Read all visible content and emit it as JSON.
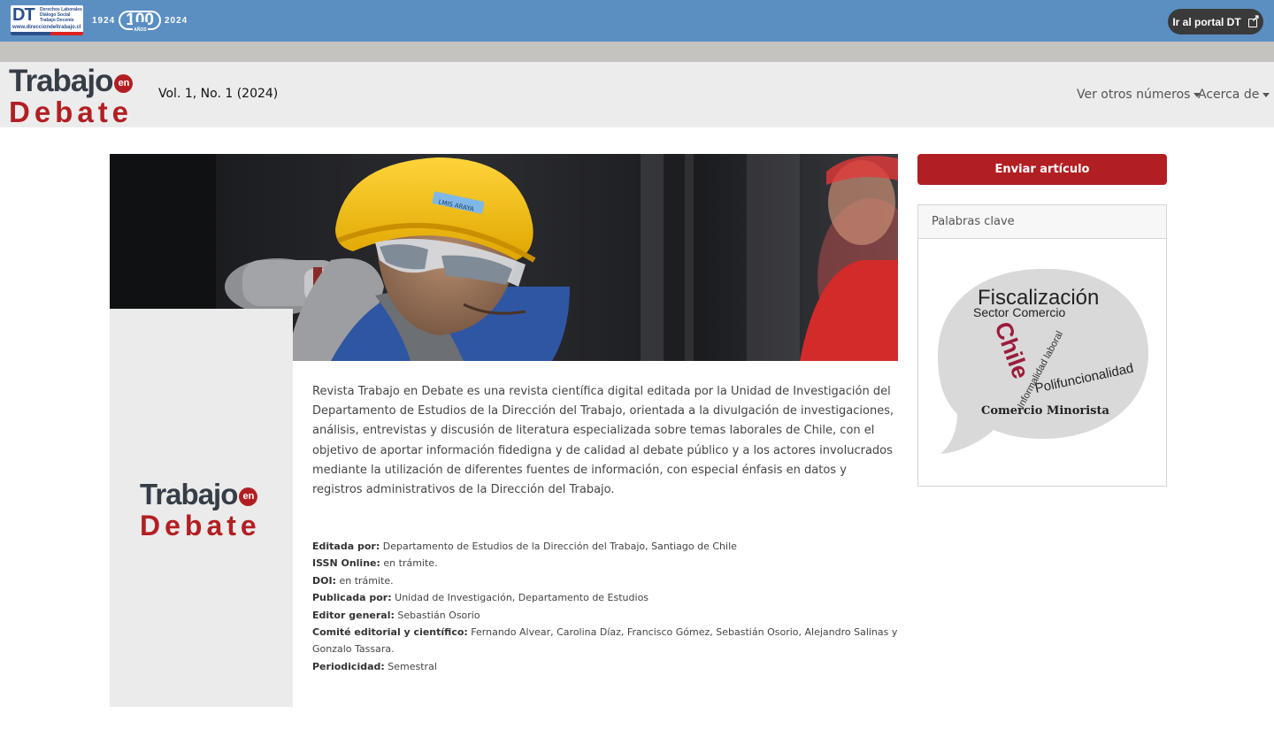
{
  "topbar": {
    "dt_logo": {
      "letters": "DT",
      "lines": [
        "Derechos Laborales",
        "Diálogo Social",
        "Trabajo Decente"
      ],
      "url": "www.direcciondeltrabajo.cl"
    },
    "anniversary": {
      "start_year": "1924",
      "number": "100",
      "label": "AÑOS",
      "end_year": "2024"
    },
    "portal_button": {
      "label": "Ir al portal DT",
      "icon": "external-link-icon"
    }
  },
  "header": {
    "logo": {
      "word1": "Trabajo",
      "badge": "en",
      "word2": "Debate"
    },
    "issue_title": "Vol. 1, No. 1 (2024)",
    "nav": [
      {
        "label": "Ver otros números",
        "icon": "chevron-down-icon"
      },
      {
        "label": "Acerca de",
        "icon": "chevron-down-icon"
      }
    ]
  },
  "main": {
    "logo": {
      "word1": "Trabajo",
      "badge": "en",
      "word2": "Debate"
    },
    "hero_helmet_label": "LMIS ARAYA",
    "description": "Revista Trabajo en Debate es una revista científica digital editada por la Unidad de Investigación del Departamento de Estudios de la Dirección del Trabajo, orientada a la divulgación de investigaciones, análisis, entrevistas y discusión de literatura especializada sobre temas laborales de Chile, con el objetivo de aportar información fidedigna y de calidad al debate público y a los actores involucrados mediante la utilización de diferentes fuentes de información, con especial énfasis en datos y registros administrativos de la Dirección del Trabajo.",
    "meta": [
      {
        "label": "Editada por:",
        "value": "Departamento de Estudios de la Dirección del Trabajo, Santiago de Chile"
      },
      {
        "label": "ISSN Online:",
        "value": "en trámite."
      },
      {
        "label": "DOI:",
        "value": "en trámite."
      },
      {
        "label": "Publicada por:",
        "value": "Unidad de Investigación, Departamento de Estudios"
      },
      {
        "label": "Editor general:",
        "value": "Sebastián Osorio"
      },
      {
        "label": "Comité editorial y científico:",
        "value": "Fernando Alvear, Carolina Díaz, Francisco Gómez, Sebastián Osorio, Alejandro Salinas y Gonzalo Tassara."
      },
      {
        "label": "Periodicidad:",
        "value": "Semestral"
      }
    ]
  },
  "sidebar": {
    "submit_label": "Enviar artículo",
    "keywords_title": "Palabras clave",
    "keywords": {
      "fiscalizacion": "Fiscalización",
      "sector_comercio": "Sector Comercio",
      "chile": "Chile",
      "informalidad": "Informalidad laboral",
      "polifuncionalidad": "Polifuncionalidad",
      "comercio_minorista": "Comercio Minorista"
    }
  },
  "colors": {
    "topbar": "#5b8fc2",
    "brand_red": "#b21f23",
    "brand_dark": "#363d46",
    "header_bg": "#ececec",
    "chile_word": "#9c1b3c"
  }
}
